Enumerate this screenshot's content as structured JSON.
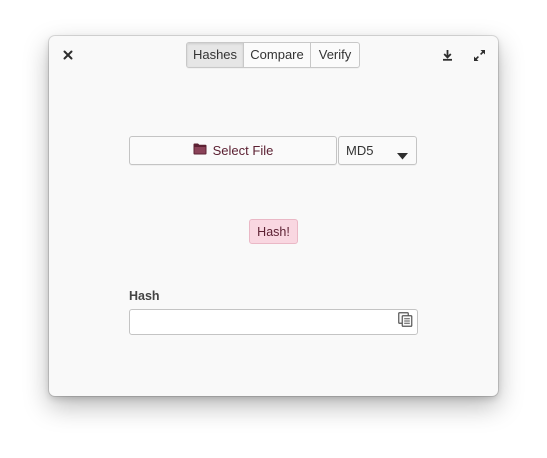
{
  "header": {
    "close_icon": "close-icon",
    "download_icon": "download-icon",
    "maximize_icon": "maximize-icon",
    "tabs": [
      {
        "label": "Hashes",
        "active": true
      },
      {
        "label": "Compare",
        "active": false
      },
      {
        "label": "Verify",
        "active": false
      }
    ]
  },
  "main": {
    "select_file_icon": "folder-icon",
    "select_file_label": "Select File",
    "algorithm": {
      "selected": "MD5"
    },
    "hash_button_label": "Hash!",
    "hash_field": {
      "label": "Hash",
      "value": "",
      "placeholder": ""
    },
    "copy_icon": "copy-icon"
  },
  "colors": {
    "accent_text": "#5c2133",
    "accent_background": "#f9d7e1",
    "window_background": "#f9f9f9"
  }
}
